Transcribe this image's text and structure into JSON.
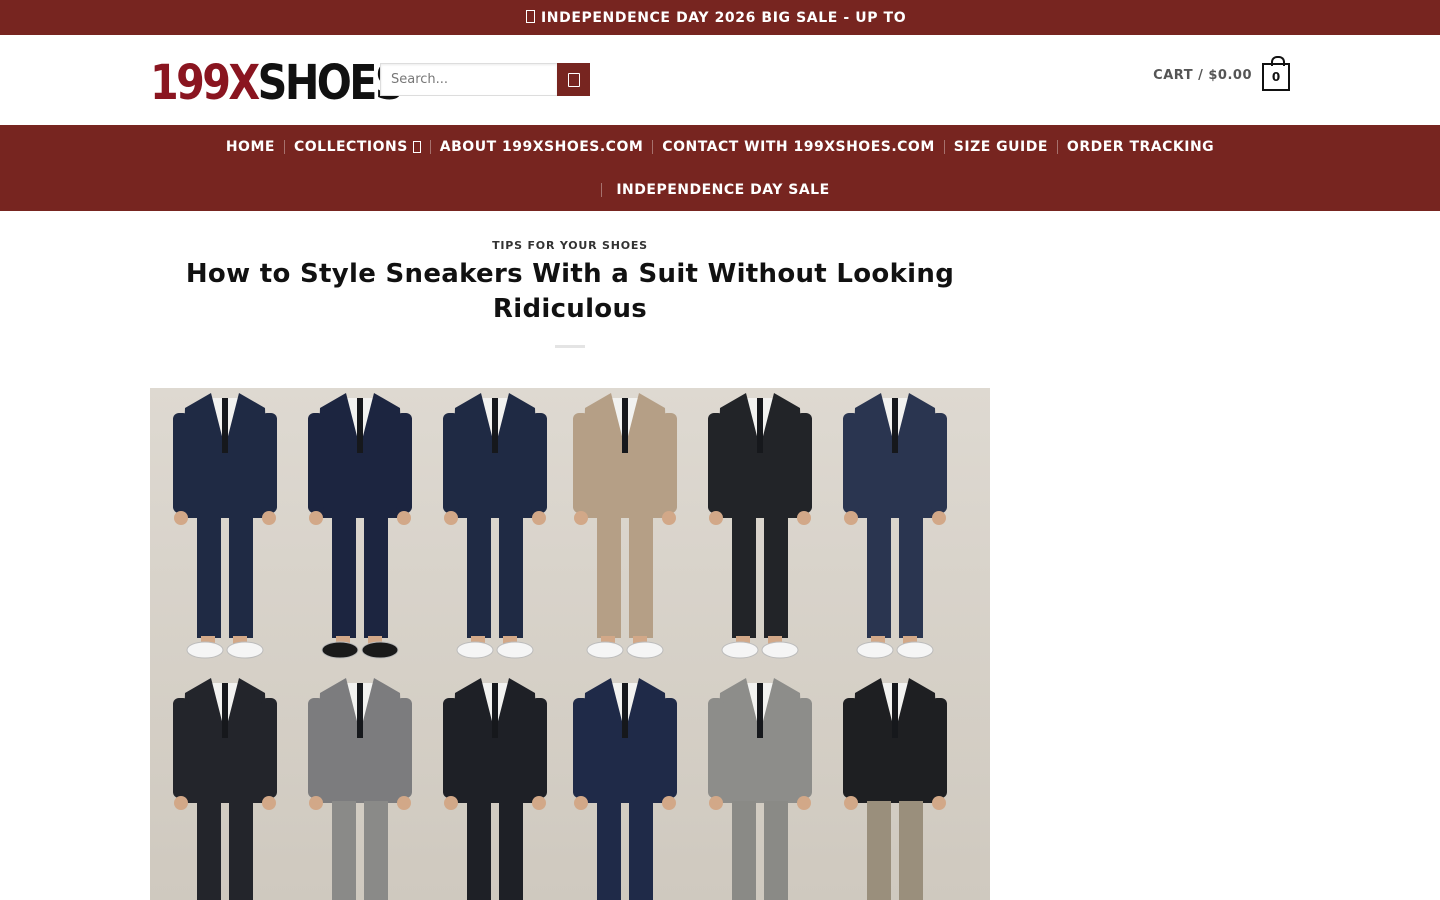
{
  "topbar": {
    "icon": "flag-icon",
    "text": "INDEPENDENCE DAY 2026 BIG SALE - UP TO"
  },
  "header": {
    "logo_part1": "199X",
    "logo_part2": "SHOES",
    "search_placeholder": "Search...",
    "search_icon": "search-icon",
    "cart_label": "CART / $0.00",
    "cart_count": "0"
  },
  "nav": {
    "items": [
      {
        "label": "HOME"
      },
      {
        "label": "COLLECTIONS"
      },
      {
        "label": "ABOUT 199XSHOES.COM"
      },
      {
        "label": "CONTACT WITH 199XSHOES.COM"
      },
      {
        "label": "SIZE GUIDE"
      },
      {
        "label": "ORDER TRACKING"
      },
      {
        "label": "INDEPENDENCE DAY SALE"
      }
    ]
  },
  "article": {
    "category": "TIPS FOR YOUR SHOES",
    "title": "How to Style Sneakers With a Suit Without Looking Ridiculous"
  },
  "colors": {
    "brand": "#772520",
    "logo_red": "#8a1520"
  }
}
